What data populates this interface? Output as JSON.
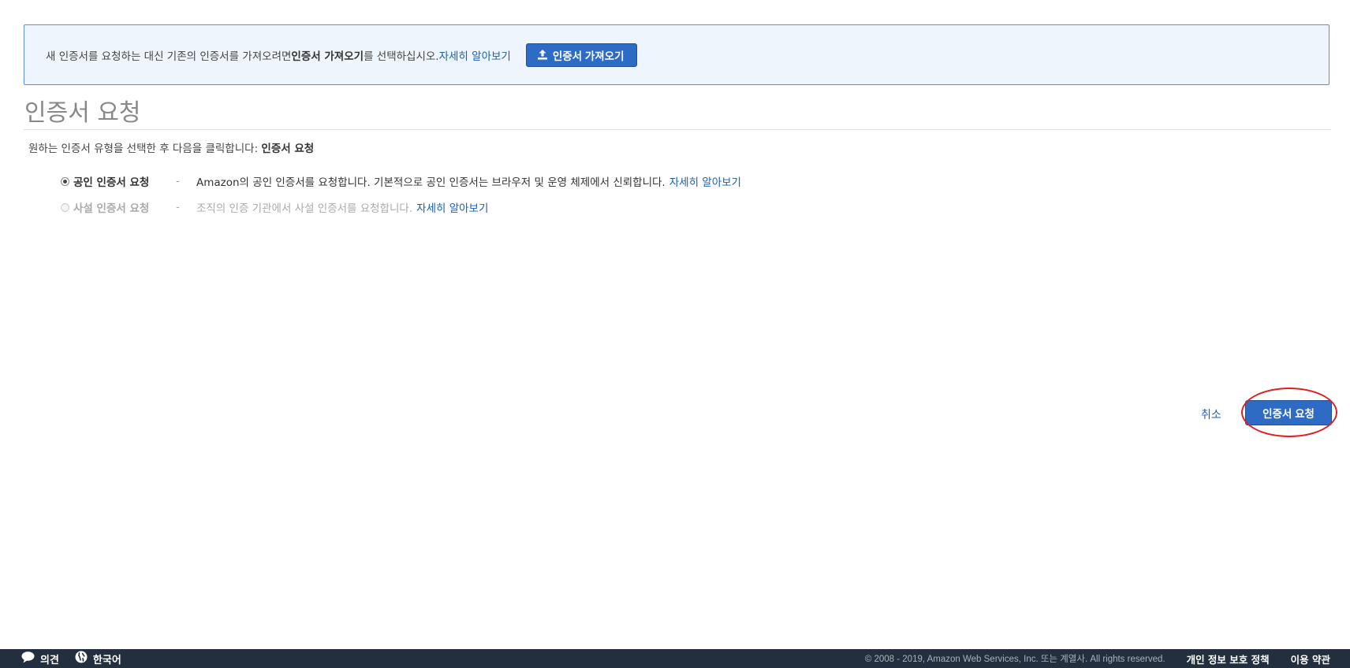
{
  "import_notice": {
    "text_before": "새 인증서를 요청하는 대신 기존의 인증서를 가져오려면 ",
    "text_strong": "인증서 가져오기",
    "text_after": "를 선택하십시오. ",
    "learn_more": "자세히 알아보기",
    "import_button": "인증서 가져오기",
    "import_icon": "upload-icon"
  },
  "page_title": "인증서 요청",
  "instruction": {
    "text": "원하는 인증서 유형을 선택한 후 다음을 클릭합니다: ",
    "strong": "인증서 요청"
  },
  "options": [
    {
      "label": "공인 인증서 요청",
      "separator": "-",
      "description": "Amazon의 공인 인증서를 요청합니다. 기본적으로 공인 인증서는 브라우저 및 운영 체제에서 신뢰합니다.",
      "learn_more": "자세히 알아보기",
      "selected": true,
      "disabled": false
    },
    {
      "label": "사설 인증서 요청",
      "separator": "-",
      "description": "조직의 인증 기관에서 사설 인증서를 요청합니다.",
      "learn_more": "자세히 알아보기",
      "selected": false,
      "disabled": true
    }
  ],
  "actions": {
    "cancel": "취소",
    "request": "인증서 요청"
  },
  "footer": {
    "feedback": "의견",
    "feedback_icon": "speech-bubble-icon",
    "language": "한국어",
    "language_icon": "globe-icon",
    "copyright": "© 2008 - 2019, Amazon Web Services, Inc. 또는 계열사. All rights reserved.",
    "privacy": "개인 정보 보호 정책",
    "terms": "이용 약관"
  },
  "colors": {
    "primary_button": "#2d6bc4",
    "link": "#1a5fb4",
    "info_border": "#5c8fd6",
    "info_background": "#eef5fc",
    "footer_background": "#232f3e",
    "annotation": "#dd2222"
  }
}
